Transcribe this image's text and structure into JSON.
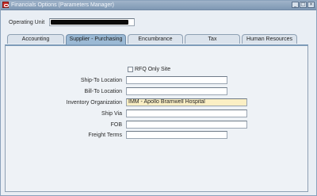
{
  "window": {
    "title": "Financials Options (Parameters Manager)",
    "app_icon": "oracle-icon",
    "controls": {
      "minimize": "_",
      "maximize": "□",
      "close": "×"
    }
  },
  "operating_unit": {
    "label": "Operating Unit",
    "value": ""
  },
  "tabs": [
    {
      "label": "Accounting",
      "active": false
    },
    {
      "label": "Supplier - Purchasing",
      "active": true
    },
    {
      "label": "Encumbrance",
      "active": false
    },
    {
      "label": "Tax",
      "active": false
    },
    {
      "label": "Human Resources",
      "active": false
    }
  ],
  "form": {
    "rfq_only_site": {
      "label": "RFQ Only Site",
      "checked": false
    },
    "ship_to_location": {
      "label": "Ship-To Location",
      "value": ""
    },
    "bill_to_location": {
      "label": "Bill-To Location",
      "value": ""
    },
    "inventory_organization": {
      "label": "Inventory Organization",
      "value": "IMM - Apollo Bramwell Hospital"
    },
    "ship_via": {
      "label": "Ship Via",
      "value": ""
    },
    "fob": {
      "label": "FOB",
      "value": ""
    },
    "freight_terms": {
      "label": "Freight Terms",
      "value": ""
    }
  },
  "colors": {
    "title_bar": "#8aa2bc",
    "active_tab": "#9bb9d4",
    "required_field": "#fbefc4"
  }
}
